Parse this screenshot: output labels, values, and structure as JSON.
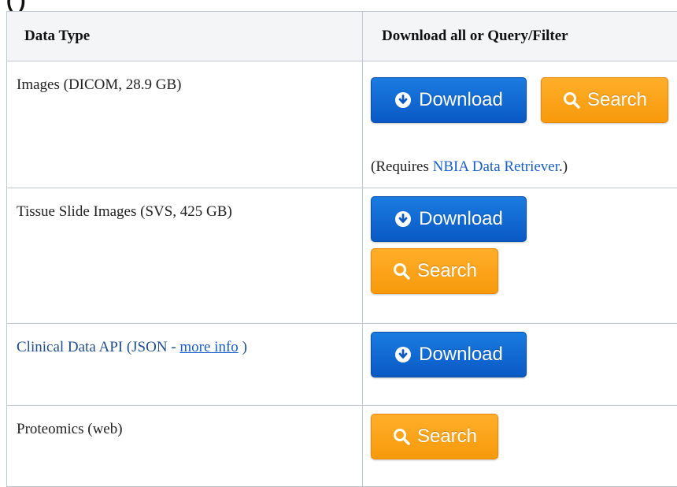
{
  "heading": "(          )",
  "table": {
    "headers": [
      "Data Type",
      "Download all or Query/Filter"
    ],
    "rows": [
      {
        "label": "Images (DICOM, 28.9 GB)",
        "note_prefix": "(Requires ",
        "note_link": "NBIA Data Retriever",
        "note_suffix": ".)"
      },
      {
        "label": "Tissue Slide Images (SVS, 425 GB)"
      },
      {
        "label_prefix": "Clinical Data API (JSON -  ",
        "label_link": "more info",
        "label_suffix": " )"
      },
      {
        "label": "Proteomics (web)"
      }
    ]
  },
  "buttons": {
    "download": "Download",
    "search": "Search"
  },
  "icons": {
    "download": "arrow-circle-down-icon",
    "search": "search-icon"
  },
  "colors": {
    "download_button": "#0a59c4",
    "search_button": "#f79a0b",
    "link": "#1a5fc8",
    "header_bg": "#f4f5f7",
    "border": "#c1c7d0"
  }
}
